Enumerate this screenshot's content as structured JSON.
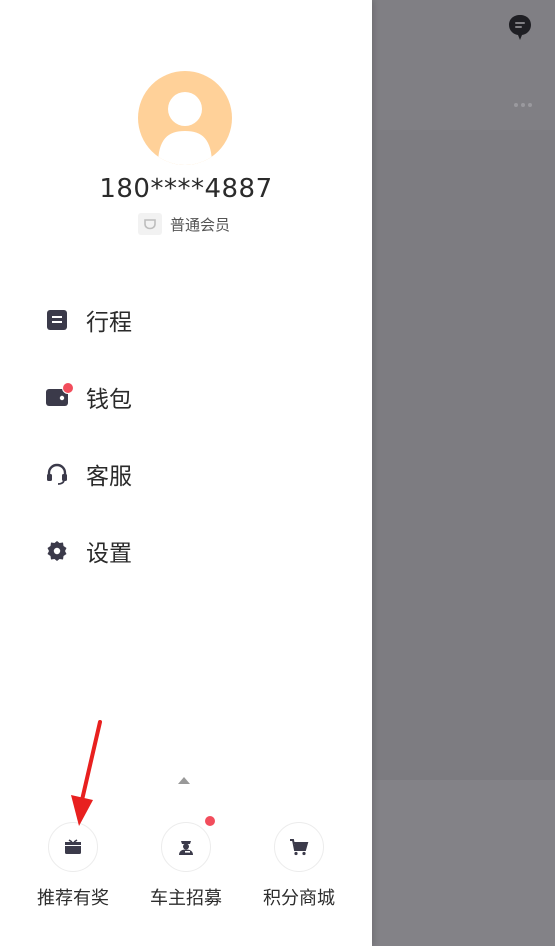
{
  "user": {
    "phone": "180****4887",
    "member_level": "普通会员"
  },
  "menu": {
    "items": [
      {
        "label": "行程",
        "icon": "itinerary-icon"
      },
      {
        "label": "钱包",
        "icon": "wallet-icon",
        "badge": true
      },
      {
        "label": "客服",
        "icon": "headset-icon"
      },
      {
        "label": "设置",
        "icon": "settings-icon"
      }
    ]
  },
  "bottom_bar": {
    "items": [
      {
        "label": "推荐有奖",
        "icon": "gift-icon"
      },
      {
        "label": "车主招募",
        "icon": "driver-icon",
        "badge": true
      },
      {
        "label": "积分商城",
        "icon": "cart-icon"
      }
    ]
  },
  "colors": {
    "avatar_bg": "#ffd199",
    "badge_red": "#f24d5c",
    "icon_dark": "#3b3a4a",
    "overlay": "#7c7b80",
    "annotation_arrow": "#e8201f"
  }
}
